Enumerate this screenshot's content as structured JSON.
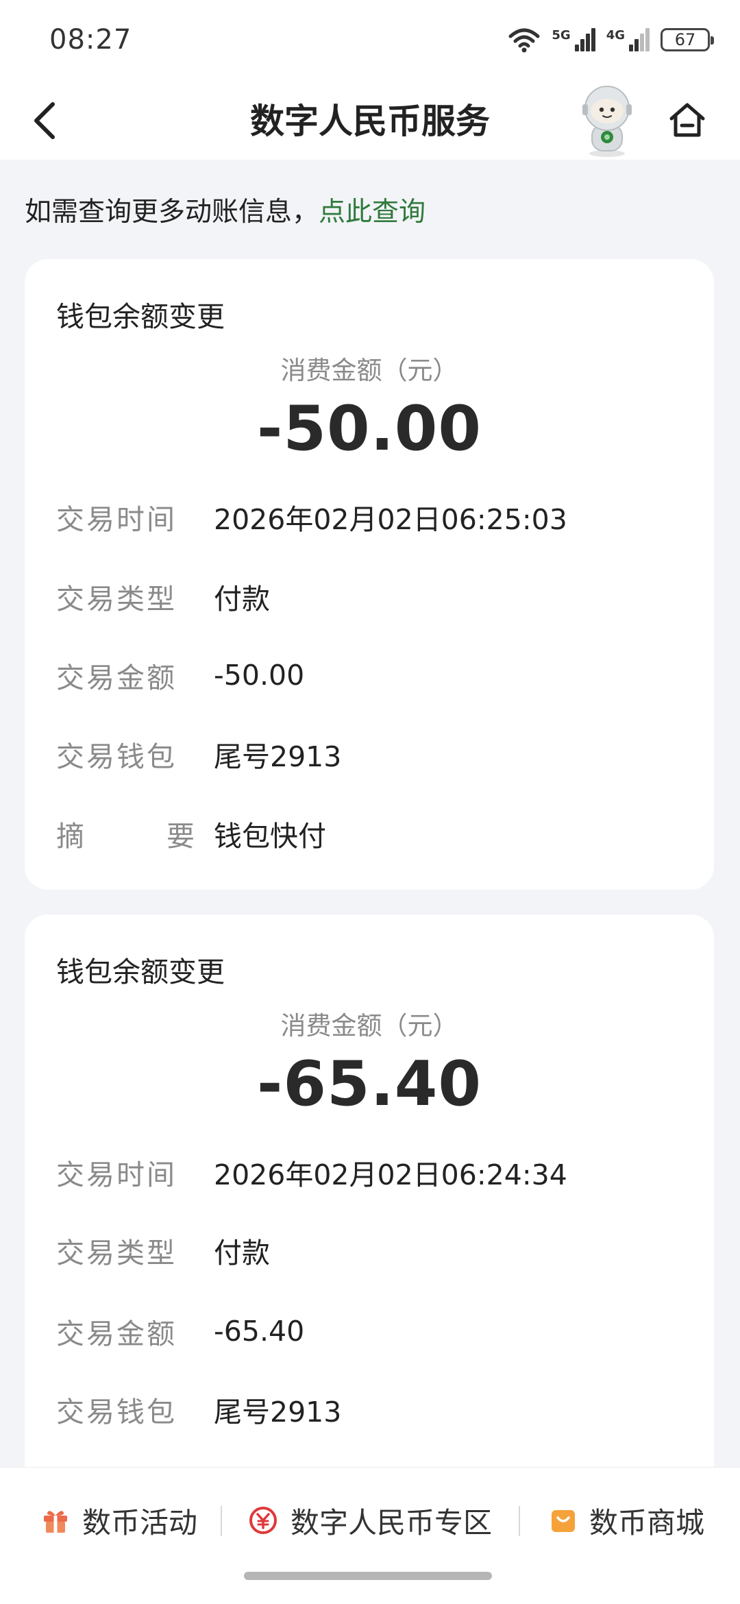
{
  "status_bar": {
    "time": "08:27",
    "net1": "5G",
    "net2": "4G",
    "battery": "67"
  },
  "header": {
    "title": "数字人民币服务",
    "back_icon": "chevron-left-icon",
    "assistant_icon": "robot-avatar-icon",
    "home_icon": "home-icon"
  },
  "hint": {
    "text": "如需查询更多动账信息，",
    "link": "点此查询"
  },
  "transactions": [
    {
      "title": "钱包余额变更",
      "amount_label": "消费金额（元）",
      "amount": "-50.00",
      "rows": {
        "time_label": "交易时间",
        "time": "2026年02月02日06:25:03",
        "type_label": "交易类型",
        "type": "付款",
        "amount_label": "交易金额",
        "amount": "-50.00",
        "wallet_label": "交易钱包",
        "wallet": "尾号2913",
        "summary_label_a": "摘",
        "summary_label_b": "要",
        "summary": "钱包快付"
      }
    },
    {
      "title": "钱包余额变更",
      "amount_label": "消费金额（元）",
      "amount": "-65.40",
      "rows": {
        "time_label": "交易时间",
        "time": "2026年02月02日06:24:34",
        "type_label": "交易类型",
        "type": "付款",
        "amount_label": "交易金额",
        "amount": "-65.40",
        "wallet_label": "交易钱包",
        "wallet": "尾号2913"
      }
    }
  ],
  "bottom_bar": {
    "activity": {
      "label": "数币活动",
      "icon": "gift-icon"
    },
    "zone": {
      "label": "数字人民币专区",
      "icon": "e-cny-icon"
    },
    "mall": {
      "label": "数币商城",
      "icon": "shopping-bag-icon"
    }
  },
  "colors": {
    "link_green": "#2f7a3c",
    "background": "#f3f4f8",
    "accent_red": "#e0383a",
    "accent_orange": "#f5a23b"
  }
}
